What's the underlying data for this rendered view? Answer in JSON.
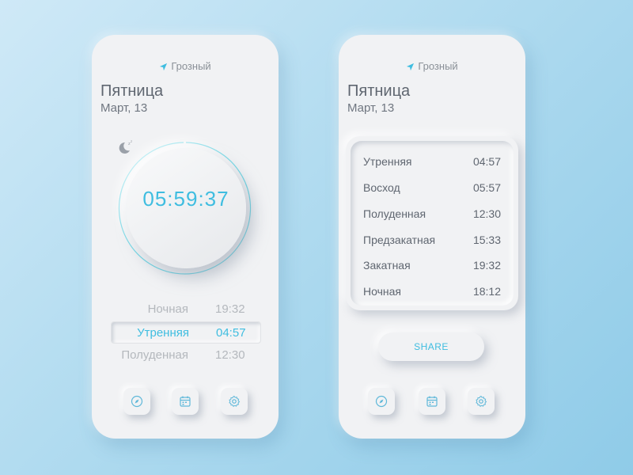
{
  "colors": {
    "accent": "#3fbde0",
    "text": "#5f6670",
    "muted": "#b4b8bd",
    "icon": "#5fb8d9"
  },
  "left_phone": {
    "location": "Грозный",
    "day": "Пятница",
    "date": "Март, 13",
    "countdown": "05:59:37",
    "prayers": [
      {
        "name": "Ночная",
        "time": "19:32"
      },
      {
        "name": "Утренняя",
        "time": "04:57"
      },
      {
        "name": "Полуденная",
        "time": "12:30"
      }
    ],
    "nav": [
      {
        "icon": "compass-icon"
      },
      {
        "icon": "calendar-icon"
      },
      {
        "icon": "gear-icon"
      }
    ]
  },
  "right_phone": {
    "location": "Грозный",
    "day": "Пятница",
    "date": "Март, 13",
    "schedule": [
      {
        "name": "Утренняя",
        "time": "04:57"
      },
      {
        "name": "Восход",
        "time": "05:57"
      },
      {
        "name": "Полуденная",
        "time": "12:30"
      },
      {
        "name": "Предзакатная",
        "time": "15:33"
      },
      {
        "name": "Закатная",
        "time": "19:32"
      },
      {
        "name": "Ночная",
        "time": "18:12"
      }
    ],
    "share_label": "SHARE",
    "nav": [
      {
        "icon": "compass-icon"
      },
      {
        "icon": "calendar-icon"
      },
      {
        "icon": "gear-icon"
      }
    ]
  }
}
